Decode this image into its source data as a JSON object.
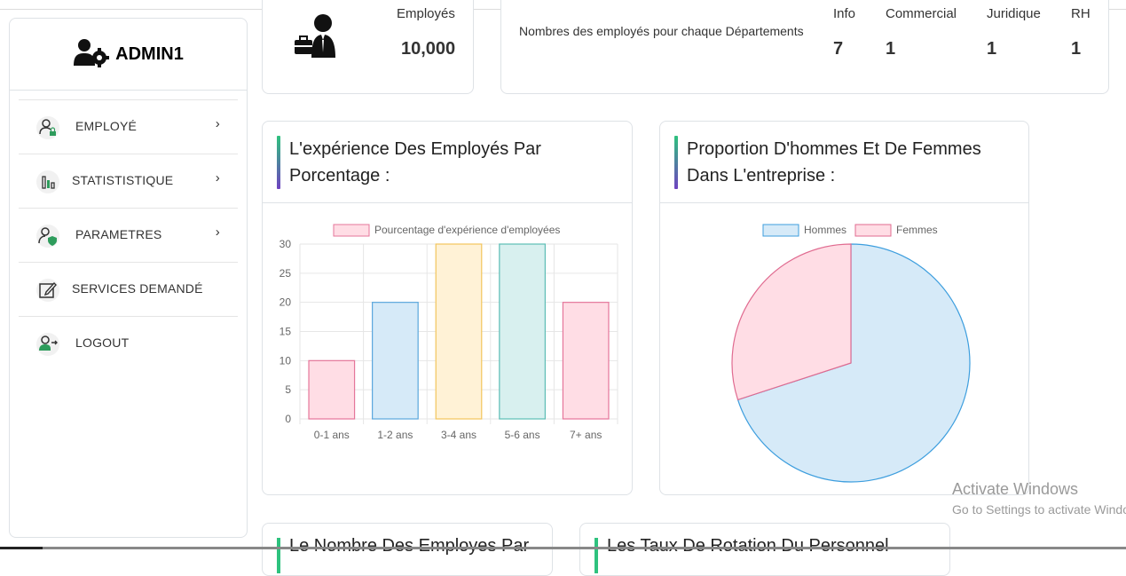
{
  "sidebar": {
    "title": "ADMIN1",
    "items": [
      {
        "label": "EMPLOYÉ",
        "has_chevron": true
      },
      {
        "label": "STATISTISTIQUE",
        "has_chevron": true
      },
      {
        "label": "PARAMETRES",
        "has_chevron": true
      },
      {
        "label": "SERVICES DEMANDÉ",
        "has_chevron": false
      },
      {
        "label": "LOGOUT",
        "has_chevron": false
      }
    ],
    "chevron": "›"
  },
  "stat_card": {
    "label": "Employés",
    "value": "10,000"
  },
  "dept_card": {
    "label": "Nombres des employés pour chaque Départements",
    "departments": [
      {
        "name": "Info",
        "count": "7"
      },
      {
        "name": "Commercial",
        "count": "1"
      },
      {
        "name": "Juridique",
        "count": "1"
      },
      {
        "name": "RH",
        "count": "1"
      }
    ]
  },
  "experience_card": {
    "title": "L'expérience Des Employés Par Porcentage :"
  },
  "gender_card": {
    "title": "Proportion D'hommes Et De Femmes Dans L'entreprise :"
  },
  "bottom_cards": [
    {
      "title": "Le Nombre Des Employes Par"
    },
    {
      "title": "Les Taux De Rotation Du Personnel"
    }
  ],
  "watermark": {
    "line1": "Activate Windows",
    "line2": "Go to Settings to activate Windows."
  },
  "colors": {
    "green": "#2ec27e",
    "purple": "#6f42c1"
  },
  "chart_data": [
    {
      "type": "bar",
      "categories": [
        "0-1 ans",
        "1-2 ans",
        "3-4 ans",
        "5-6 ans",
        "7+ ans"
      ],
      "series": [
        {
          "name": "Pourcentage d'expérience d'employées",
          "values": [
            10,
            20,
            30,
            30,
            20
          ]
        }
      ],
      "ylim": [
        0,
        30
      ],
      "yticks": [
        0,
        5,
        10,
        15,
        20,
        25,
        30
      ],
      "legend": "top",
      "grid": true,
      "bar_fills": [
        "#ffdde5",
        "#d6eaf8",
        "#fff2d6",
        "#d8f0ef",
        "#ffdde5"
      ],
      "bar_strokes": [
        "#e5769a",
        "#5aa7dd",
        "#f2c55c",
        "#5cbdb5",
        "#e5769a"
      ]
    },
    {
      "type": "pie",
      "labels": [
        "Hommes",
        "Femmes"
      ],
      "values": [
        70,
        30
      ],
      "fills": [
        "#d6eaf8",
        "#ffdde5"
      ],
      "strokes": [
        "#3d9ede",
        "#e06b90"
      ],
      "legend": "top"
    }
  ]
}
